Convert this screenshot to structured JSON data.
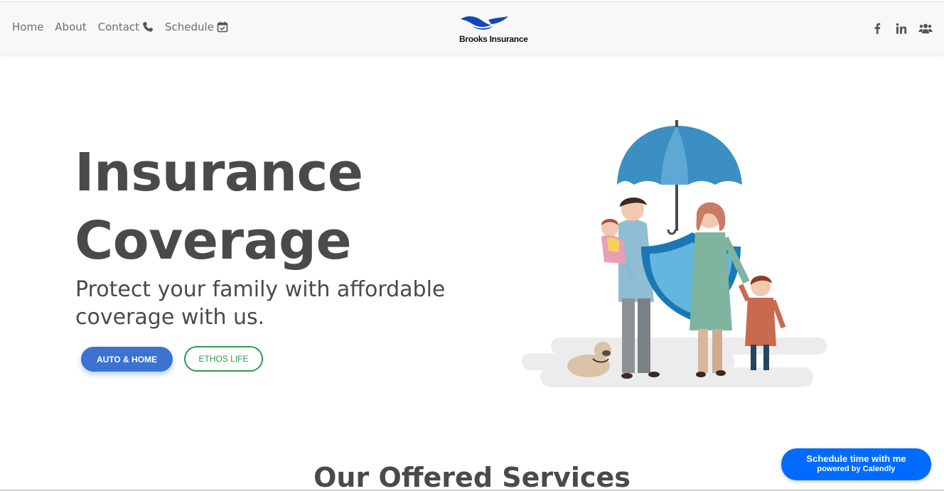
{
  "nav": {
    "links": [
      {
        "label": "Home"
      },
      {
        "label": "About"
      },
      {
        "label": "Contact"
      },
      {
        "label": "Schedule"
      }
    ],
    "logo_text": "Brooks Insurance",
    "social": [
      "facebook-icon",
      "linkedin-icon",
      "users-icon"
    ]
  },
  "hero": {
    "title": "Insurance Coverage",
    "subtitle": "Protect your family with affordable coverage with us.",
    "primary_button": "AUTO & HOME",
    "secondary_button": "ETHOS LIFE"
  },
  "services": {
    "title": "Our Offered Services"
  },
  "calendly": {
    "line1": "Schedule time with me",
    "line2": "powered by Calendly"
  },
  "colors": {
    "primary": "#3c72d0",
    "secondary": "#2c9a4e",
    "calendly": "#006bff",
    "text": "#4a4a4a"
  }
}
